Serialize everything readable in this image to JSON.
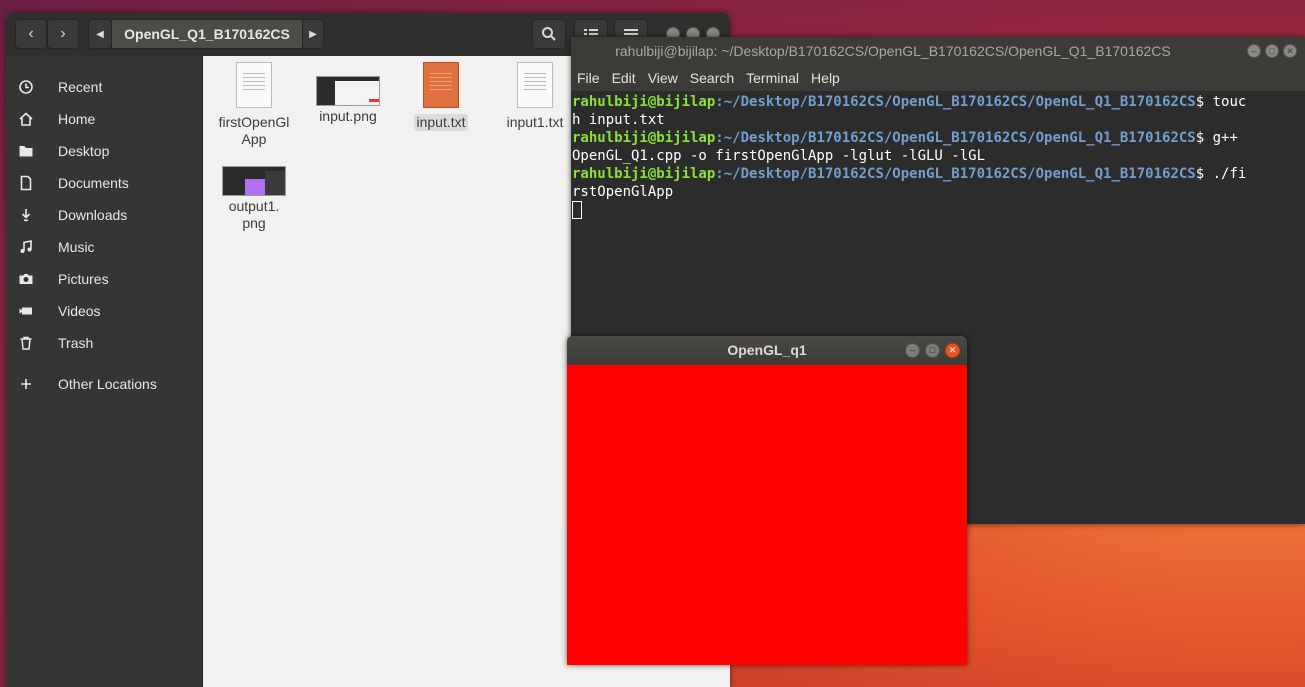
{
  "files": {
    "path_segment": "OpenGL_Q1_B170162CS",
    "icons": {
      "back": "chevron-left-icon",
      "forward": "chevron-right-icon",
      "search": "search-icon",
      "view": "list-view-icon",
      "menu": "hamburger-menu-icon"
    },
    "sidebar": [
      {
        "label": "Recent",
        "icon": "clock-icon"
      },
      {
        "label": "Home",
        "icon": "home-icon"
      },
      {
        "label": "Desktop",
        "icon": "folder-icon"
      },
      {
        "label": "Documents",
        "icon": "document-icon"
      },
      {
        "label": "Downloads",
        "icon": "download-icon"
      },
      {
        "label": "Music",
        "icon": "music-icon"
      },
      {
        "label": "Pictures",
        "icon": "camera-icon"
      },
      {
        "label": "Videos",
        "icon": "video-icon"
      },
      {
        "label": "Trash",
        "icon": "trash-icon"
      },
      {
        "label": "Other Locations",
        "icon": "plus-icon"
      }
    ],
    "items": [
      {
        "line1": "firstOpenGl",
        "line2": "App",
        "type": "executable"
      },
      {
        "line1": "input.png",
        "line2": "",
        "type": "image"
      },
      {
        "line1": "input.txt",
        "line2": "",
        "type": "text",
        "selected": true
      },
      {
        "line1": "input1.txt",
        "line2": "",
        "type": "text-plain"
      },
      {
        "line1": "output1.",
        "line2": "png",
        "type": "image"
      }
    ]
  },
  "terminal": {
    "title": "rahulbiji@bijilap: ~/Desktop/B170162CS/OpenGL_B170162CS/OpenGL_Q1_B170162CS",
    "menu": [
      "File",
      "Edit",
      "View",
      "Search",
      "Terminal",
      "Help"
    ],
    "prompt_user": "rahulbiji@bijilap",
    "prompt_path": ":~/Desktop/B170162CS/OpenGL_B170162CS/OpenGL_Q1_B170162CS",
    "lines": [
      {
        "cmd": "$ touc",
        "cont": "h input.txt"
      },
      {
        "cmd": "$ g++",
        "cont": "OpenGL_Q1.cpp -o firstOpenGlApp -lglut -lGLU -lGL"
      },
      {
        "cmd": "$ ./fi",
        "cont": "rstOpenGlApp"
      }
    ]
  },
  "gl_window": {
    "title": "OpenGL_q1",
    "fill_color": "#ff0000"
  },
  "colors": {
    "accent": "#e95420",
    "terminal_user": "#8ae234",
    "terminal_path": "#729fcf"
  }
}
